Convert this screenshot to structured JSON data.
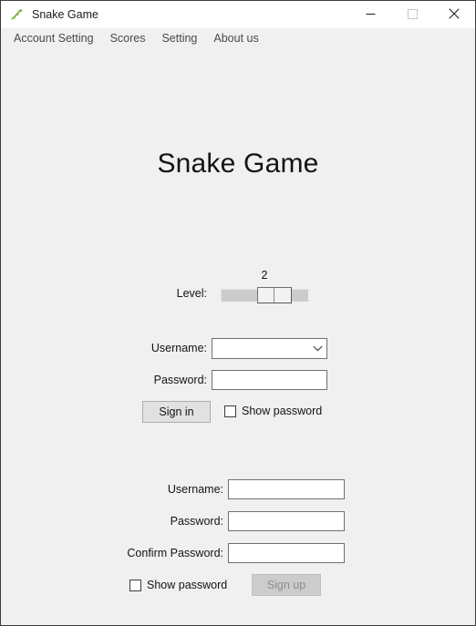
{
  "window": {
    "title": "Snake Game",
    "icon": "snake-icon",
    "controls": {
      "minimize": "minimize-icon",
      "maximize": "maximize-icon",
      "close": "close-icon"
    }
  },
  "menubar": {
    "items": [
      {
        "label": "Account Setting"
      },
      {
        "label": "Scores"
      },
      {
        "label": "Setting"
      },
      {
        "label": "About us"
      }
    ]
  },
  "main": {
    "heading": "Snake Game",
    "level": {
      "label": "Level:",
      "value": "2",
      "min": 1,
      "max": 3,
      "current": 2
    },
    "signin": {
      "username_label": "Username:",
      "username_value": "",
      "password_label": "Password:",
      "password_value": "",
      "submit_label": "Sign in",
      "show_password_label": "Show password",
      "show_password_checked": false
    },
    "signup": {
      "username_label": "Username:",
      "username_value": "",
      "password_label": "Password:",
      "password_value": "",
      "confirm_label": "Confirm Password:",
      "confirm_value": "",
      "show_password_label": "Show password",
      "show_password_checked": false,
      "submit_label": "Sign up",
      "submit_disabled": true
    }
  },
  "colors": {
    "titlebar_bg": "#ffffff",
    "client_bg": "#f0f0f0",
    "window_border": "#3c3c3c",
    "text": "#141414",
    "menu_text": "#4a4a4a",
    "field_border": "#707070",
    "button_bg": "#e1e1e1",
    "button_disabled_bg": "#cccccc",
    "button_disabled_text": "#8d8d8d",
    "slider_track": "#cccccc",
    "icon_green": "#7bb244"
  }
}
